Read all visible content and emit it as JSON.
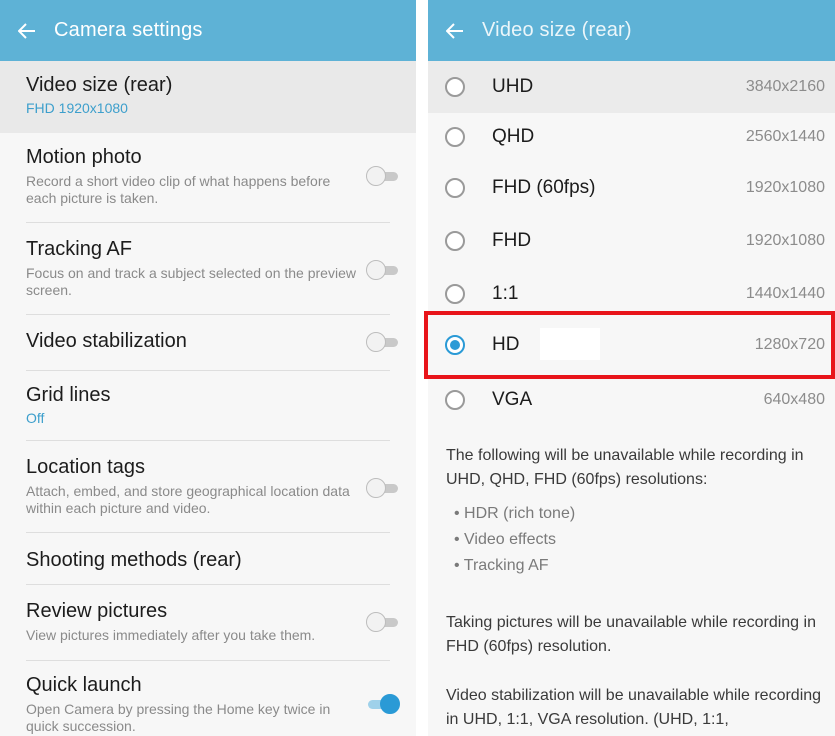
{
  "left": {
    "header": {
      "back_icon": "arrow-left-icon",
      "title": "Camera settings"
    },
    "items": [
      {
        "title": "Video size (rear)",
        "value": "FHD 1920x1080"
      },
      {
        "title": "Motion photo",
        "subtitle": "Record a short video clip of what happens before each picture is taken.",
        "toggle": "off"
      },
      {
        "title": "Tracking AF",
        "subtitle": "Focus on and track a subject selected on the preview screen.",
        "toggle": "off"
      },
      {
        "title": "Video stabilization",
        "toggle": "off"
      },
      {
        "title": "Grid lines",
        "value": "Off"
      },
      {
        "title": "Location tags",
        "subtitle": "Attach, embed, and store geographical location data within each picture and video.",
        "toggle": "off"
      },
      {
        "title": "Shooting methods (rear)"
      },
      {
        "title": "Review pictures",
        "subtitle": "View pictures immediately after you take them.",
        "toggle": "off"
      },
      {
        "title": "Quick launch",
        "subtitle": "Open Camera by pressing the Home key twice in quick succession.",
        "toggle": "on"
      }
    ]
  },
  "right": {
    "header": {
      "back_icon": "arrow-left-icon",
      "title": "Video size (rear)"
    },
    "options": [
      {
        "name": "UHD",
        "resolution": "3840x2160",
        "selected": false
      },
      {
        "name": "QHD",
        "resolution": "2560x1440",
        "selected": false
      },
      {
        "name": "FHD (60fps)",
        "resolution": "1920x1080",
        "selected": false
      },
      {
        "name": "FHD",
        "resolution": "1920x1080",
        "selected": false
      },
      {
        "name": "1:1",
        "resolution": "1440x1440",
        "selected": false
      },
      {
        "name": "HD",
        "resolution": "1280x720",
        "selected": true
      },
      {
        "name": "VGA",
        "resolution": "640x480",
        "selected": false
      }
    ],
    "info1": "The following will be unavailable while recording in UHD, QHD, FHD (60fps) resolutions:",
    "bullets": [
      "• HDR (rich tone)",
      "• Video effects",
      "• Tracking AF"
    ],
    "info2": "Taking pictures will be unavailable while recording in FHD (60fps) resolution.",
    "info3": "Video stabilization will be unavailable while recording in UHD, 1:1, VGA resolution. (UHD, 1:1,"
  },
  "colors": {
    "appbar": "#5eb2d6",
    "accent": "#2a9ad6",
    "highlight": "#e8141a"
  }
}
